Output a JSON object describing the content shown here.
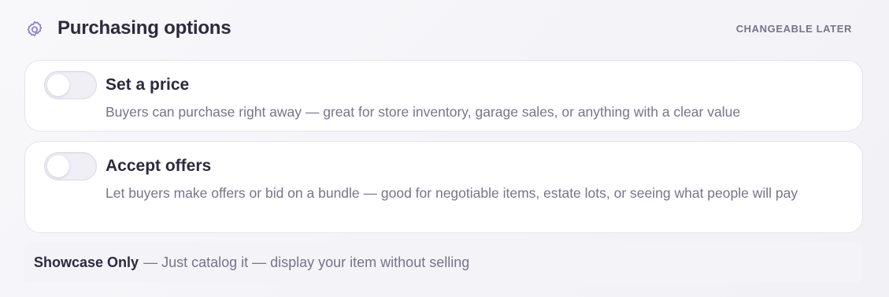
{
  "header": {
    "title": "Purchasing options",
    "note": "CHANGEABLE LATER",
    "icon": "gear-icon"
  },
  "options": [
    {
      "title": "Set a price",
      "description": "Buyers can purchase right away — great for store inventory, garage sales, or anything with a clear value",
      "enabled": false
    },
    {
      "title": "Accept offers",
      "description": "Let buyers make offers or bid on a bundle — good for negotiable items, estate lots, or seeing what people will pay",
      "enabled": false
    }
  ],
  "showcase": {
    "label": "Showcase Only",
    "description": "— Just catalog it — display your item without selling"
  },
  "colors": {
    "accent": "#8b7fd9",
    "text": "#2d2a3e",
    "muted": "#76748a"
  }
}
